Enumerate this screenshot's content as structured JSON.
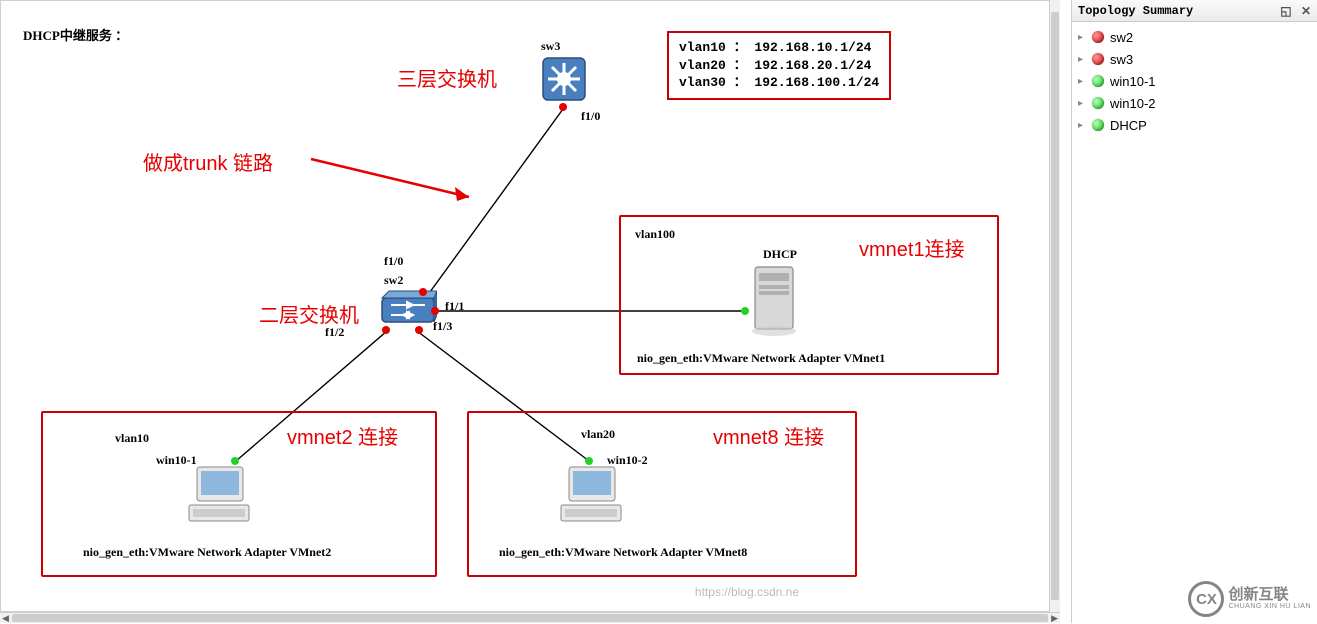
{
  "diagram": {
    "title": "DHCP中继服务 ：",
    "vlan_box": "vlan10 ： 192.168.10.1/24\nvlan20 ： 192.168.20.1/24\nvlan30 ： 192.168.100.1/24",
    "annotations": {
      "l3_switch": "三层交换机",
      "trunk_link": "做成trunk 链路",
      "l2_switch": "二层交换机",
      "vmnet1": "vmnet1连接",
      "vmnet2": "vmnet2 连接",
      "vmnet8": "vmnet8 连接"
    },
    "nodes": {
      "sw3": {
        "label": "sw3",
        "port_f10": "f1/0"
      },
      "sw2": {
        "label": "sw2",
        "port_f10": "f1/0",
        "port_f11": "f1/1",
        "port_f12": "f1/2",
        "port_f13": "f1/3"
      },
      "dhcp": {
        "box_label": "vlan100",
        "label": "DHCP",
        "adapter": "nio_gen_eth:VMware Network Adapter VMnet1"
      },
      "win10_1": {
        "box_label": "vlan10",
        "label": "win10-1",
        "adapter": "nio_gen_eth:VMware Network Adapter VMnet2"
      },
      "win10_2": {
        "box_label": "vlan20",
        "label": "win10-2",
        "adapter": "nio_gen_eth:VMware Network Adapter VMnet8"
      }
    }
  },
  "side_panel": {
    "title": "Topology Summary",
    "items": [
      {
        "name": "sw2",
        "status": "red"
      },
      {
        "name": "sw3",
        "status": "red"
      },
      {
        "name": "win10-1",
        "status": "green"
      },
      {
        "name": "win10-2",
        "status": "green"
      },
      {
        "name": "DHCP",
        "status": "green"
      }
    ]
  },
  "watermark": {
    "name_line1": "创新互联",
    "name_line2": "CHUANG XIN HU LIAN",
    "url_fragment": "https://blog.csdn.ne"
  }
}
